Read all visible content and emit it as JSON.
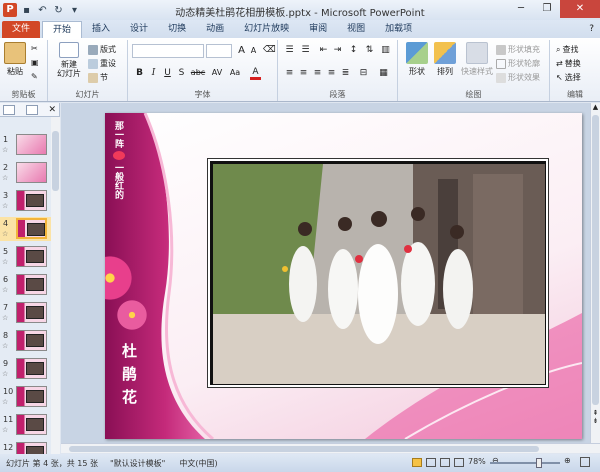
{
  "window": {
    "title": "动态精美杜鹃花相册模板.pptx - Microsoft PowerPoint",
    "close_glyph": "✕",
    "min_glyph": "─",
    "max_glyph": "❐",
    "help_glyph": "?"
  },
  "ribbon_tabs": [
    "文件",
    "开始",
    "插入",
    "设计",
    "切换",
    "动画",
    "幻灯片放映",
    "审阅",
    "视图",
    "加载项"
  ],
  "clipboard": {
    "paste": "粘贴",
    "label": "剪贴板"
  },
  "slides_group": {
    "new_slide": "新建\n幻灯片",
    "layout": "版式",
    "reset": "重设",
    "section": "节",
    "label": "幻灯片"
  },
  "font_group": {
    "label": "字体",
    "bold": "B",
    "italic": "I",
    "underline": "U",
    "shadow": "S",
    "strike": "abc",
    "spacing": "AV",
    "case": "Aa",
    "grow": "A",
    "shrink": "A"
  },
  "paragraph_group": {
    "label": "段落"
  },
  "drawing_group": {
    "shapes": "形状",
    "arrange": "排列",
    "quick_styles": "快速样式",
    "fill": "形状填充",
    "outline": "形状轮廓",
    "effects": "形状效果",
    "label": "绘图"
  },
  "editing_group": {
    "find": "查找",
    "replace": "替换",
    "select": "选择",
    "label": "编辑"
  },
  "slides": [
    {
      "num": "1",
      "type": "pink"
    },
    {
      "num": "2",
      "type": "pink"
    },
    {
      "num": "3",
      "type": "photo"
    },
    {
      "num": "4",
      "type": "photo"
    },
    {
      "num": "5",
      "type": "photo"
    },
    {
      "num": "6",
      "type": "photo"
    },
    {
      "num": "7",
      "type": "photo"
    },
    {
      "num": "8",
      "type": "photo"
    },
    {
      "num": "9",
      "type": "photo"
    },
    {
      "num": "10",
      "type": "photo"
    },
    {
      "num": "11",
      "type": "photo"
    },
    {
      "num": "12",
      "type": "photo"
    }
  ],
  "selected_slide": "4",
  "slide_content": {
    "poem_line1": "那一阵",
    "poem_line2": "一般红的",
    "title_vertical": "杜鹃花"
  },
  "status": {
    "slide_info": "幻灯片 第 4 张，共 15 张",
    "theme": "\"默认设计模板\"",
    "language": "中文(中国)",
    "zoom": "78%"
  },
  "colors": {
    "brand": "#d24726",
    "slide_magenta": "#c0206c"
  }
}
